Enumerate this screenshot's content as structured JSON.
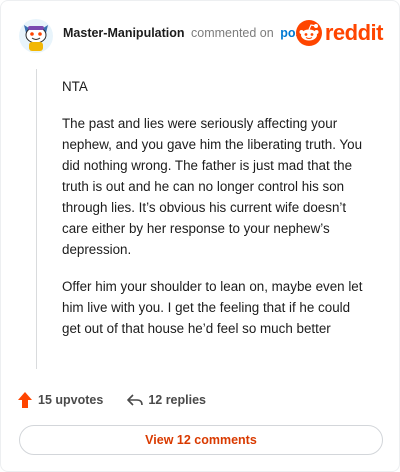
{
  "header": {
    "username": "Master-Manipulation",
    "action_text": "commented on",
    "post_link": "post",
    "brand_name": "reddit",
    "brand_color": "#ff4500",
    "avatar_icon": "snoo-avatar-icon"
  },
  "comment": {
    "paragraphs": [
      "NTA",
      "The past and lies were seriously affecting your nephew, and you gave him the liberating truth. You did nothing wrong. The father is just mad that the truth is out and he can no longer control his son through lies. It’s obvious his current wife doesn’t care either by her response to your nephew’s depression.",
      "Offer him your shoulder to lean on, maybe even let him live with you. I get the feeling that if he could get out of that house he’d feel so much better"
    ]
  },
  "actions": {
    "upvotes": "15 upvotes",
    "replies": "12 replies",
    "upvote_icon": "upvote-arrow-icon",
    "reply_icon": "reply-arrow-icon"
  },
  "footer": {
    "view_comments": "View 12 comments",
    "accent_color": "#d93a00"
  }
}
